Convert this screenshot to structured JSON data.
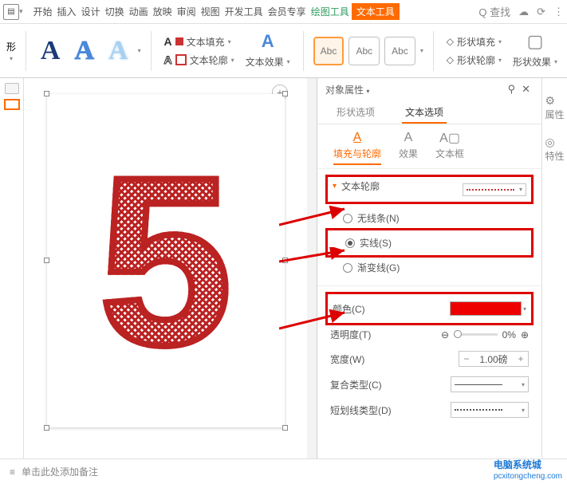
{
  "menu": {
    "items": [
      "开始",
      "插入",
      "设计",
      "切换",
      "动画",
      "放映",
      "审阅",
      "视图",
      "开发工具",
      "会员专享",
      "绘图工具",
      "文本工具"
    ],
    "search": "查找"
  },
  "ribbon": {
    "text_fill": "文本填充",
    "text_outline": "文本轮廓",
    "text_effect": "文本效果",
    "abc": "Abc",
    "shape_fill": "形状填充",
    "shape_outline": "形状轮廓",
    "shape_effect": "形状效果",
    "form": "形"
  },
  "panel": {
    "title": "对象属性",
    "tabs": {
      "shape": "形状选项",
      "text": "文本选项"
    },
    "subtabs": {
      "fill": "填充与轮廓",
      "effect": "效果",
      "textbox": "文本框"
    },
    "section": "文本轮廓",
    "radios": {
      "none": "无线条(N)",
      "solid": "实线(S)",
      "gradient": "渐变线(G)"
    },
    "props": {
      "color": "颜色(C)",
      "opacity": "透明度(T)",
      "width": "宽度(W)",
      "compound": "复合类型(C)",
      "dash": "短划线类型(D)"
    },
    "values": {
      "opacity": "0%",
      "width": "1.00磅"
    }
  },
  "right_rail": {
    "props": "属性",
    "feature": "特性"
  },
  "status": {
    "notes": "单击此处添加备注"
  },
  "watermark": {
    "title": "电脑系统城",
    "url": "pcxitongcheng.com"
  }
}
